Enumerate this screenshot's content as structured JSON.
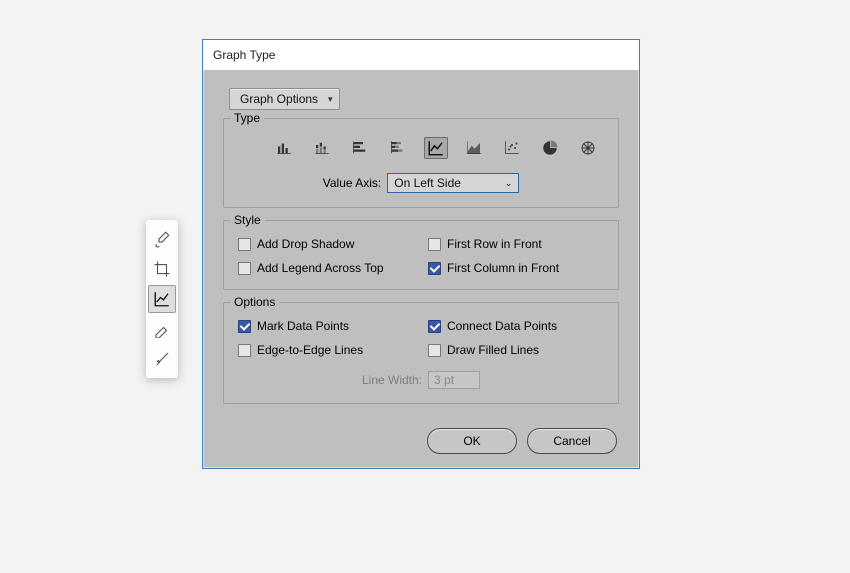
{
  "dialog": {
    "title": "Graph Type",
    "topDropdown": "Graph Options",
    "type": {
      "legend": "Type",
      "valueAxisLabel": "Value Axis:",
      "valueAxisValue": "On Left Side"
    },
    "style": {
      "legend": "Style",
      "addDropShadow": "Add Drop Shadow",
      "addLegendAcrossTop": "Add Legend Across Top",
      "firstRowInFront": "First Row in Front",
      "firstColumnInFront": "First Column in Front"
    },
    "options": {
      "legend": "Options",
      "markDataPoints": "Mark Data Points",
      "edgeToEdgeLines": "Edge-to-Edge Lines",
      "connectDataPoints": "Connect Data Points",
      "drawFilledLines": "Draw Filled Lines",
      "lineWidthLabel": "Line Width:",
      "lineWidthValue": "3 pt"
    },
    "buttons": {
      "ok": "OK",
      "cancel": "Cancel"
    }
  }
}
